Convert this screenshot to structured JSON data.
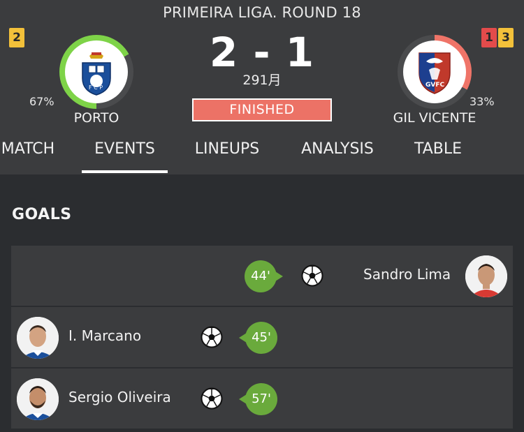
{
  "match": {
    "round": "PRIMEIRA LIGA. ROUND 18",
    "score": "2 - 1",
    "date": "291月",
    "status": "FINISHED"
  },
  "home": {
    "name": "PORTO",
    "possession": "67%",
    "possession_value": 0.67,
    "ring_color": "#7ed348",
    "yellow_cards": "2"
  },
  "away": {
    "name": "GIL VICENTE",
    "possession": "33%",
    "possession_value": 0.33,
    "ring_color": "#ef7468",
    "red_cards": "1",
    "yellow_cards": "3"
  },
  "tabs": [
    {
      "label": "MATCH"
    },
    {
      "label": "EVENTS",
      "active": true
    },
    {
      "label": "LINEUPS"
    },
    {
      "label": "ANALYSIS"
    },
    {
      "label": "TABLE"
    }
  ],
  "goals_section": {
    "title": "GOALS",
    "goals": [
      {
        "side": "away",
        "player": "Sandro Lima",
        "minute": "44'"
      },
      {
        "side": "home",
        "player": "I. Marcano",
        "minute": "45'"
      },
      {
        "side": "home",
        "player": "Sergio Oliveira",
        "minute": "57'"
      }
    ]
  },
  "colors": {
    "background": "#2b2d30",
    "header": "#3b3c3e",
    "status_badge": "#ec7266",
    "minute_badge": "#6aaa3c",
    "yellow_card": "#f3c13a",
    "red_card": "#e34b4b"
  }
}
